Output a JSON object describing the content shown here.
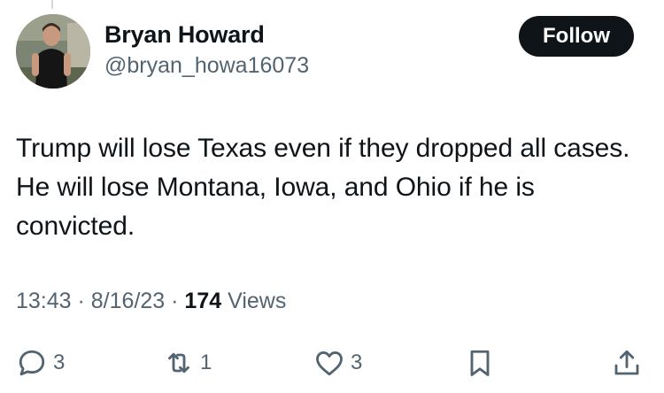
{
  "author": {
    "display_name": "Bryan Howard",
    "handle": "@bryan_howa16073"
  },
  "follow_button": {
    "label": "Follow"
  },
  "tweet": {
    "text": "Trump will lose Texas even if they dropped all cases. He will lose Montana, Iowa, and Ohio if he is convicted."
  },
  "meta": {
    "time": "13:43",
    "date": "8/16/23",
    "separator": " · ",
    "views_count": "174",
    "views_label": "Views"
  },
  "actions": {
    "reply": {
      "icon": "reply-icon",
      "count": "3"
    },
    "retweet": {
      "icon": "retweet-icon",
      "count": "1"
    },
    "like": {
      "icon": "heart-icon",
      "count": "3"
    },
    "bookmark": {
      "icon": "bookmark-icon"
    },
    "share": {
      "icon": "share-icon"
    }
  },
  "colors": {
    "text_primary": "#0f1419",
    "text_secondary": "#536471",
    "button_bg": "#0f1419",
    "button_text": "#ffffff"
  }
}
